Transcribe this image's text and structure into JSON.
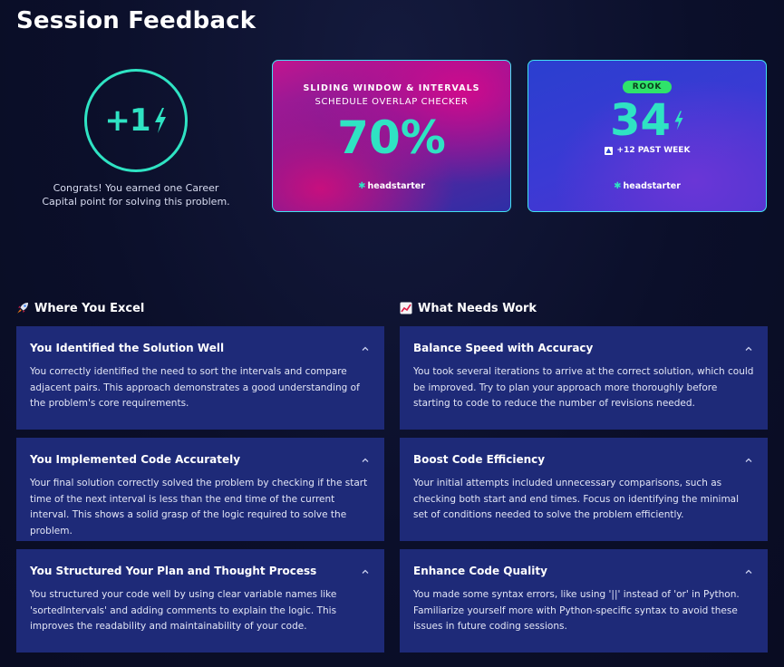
{
  "page_title": "Session Feedback",
  "career_capital": {
    "points_label": "+1",
    "message": "Congrats! You earned one Career Capital point for solving this problem.",
    "accent": "#2fe3c3"
  },
  "score_card": {
    "category": "SLIDING WINDOW & INTERVALS",
    "problem": "SCHEDULE OVERLAP CHECKER",
    "score": "70%",
    "brand": "headstarter"
  },
  "rank_card": {
    "badge": "ROOK",
    "value": "34",
    "change": "+12 PAST WEEK",
    "brand": "headstarter"
  },
  "excel_section": {
    "icon": "rocket-icon",
    "heading": "Where You Excel",
    "items": [
      {
        "title": "You Identified the Solution Well",
        "body": "You correctly identified the need to sort the intervals and compare adjacent pairs. This approach demonstrates a good understanding of the problem's core requirements."
      },
      {
        "title": "You Implemented Code Accurately",
        "body": "Your final solution correctly solved the problem by checking if the start time of the next interval is less than the end time of the current interval. This shows a solid grasp of the logic required to solve the problem."
      },
      {
        "title": "You Structured Your Plan and Thought Process",
        "body": "You structured your code well by using clear variable names like 'sortedIntervals' and adding comments to explain the logic. This improves the readability and maintainability of your code."
      }
    ]
  },
  "work_section": {
    "icon": "chart-increasing-icon",
    "heading": "What Needs Work",
    "items": [
      {
        "title": "Balance Speed with Accuracy",
        "body": "You took several iterations to arrive at the correct solution, which could be improved. Try to plan your approach more thoroughly before starting to code to reduce the number of revisions needed."
      },
      {
        "title": "Boost Code Efficiency",
        "body": "Your initial attempts included unnecessary comparisons, such as checking both start and end times. Focus on identifying the minimal set of conditions needed to solve the problem efficiently."
      },
      {
        "title": "Enhance Code Quality",
        "body": "You made some syntax errors, like using '||' instead of 'or' in Python. Familiarize yourself more with Python-specific syntax to avoid these issues in future coding sessions."
      }
    ]
  }
}
